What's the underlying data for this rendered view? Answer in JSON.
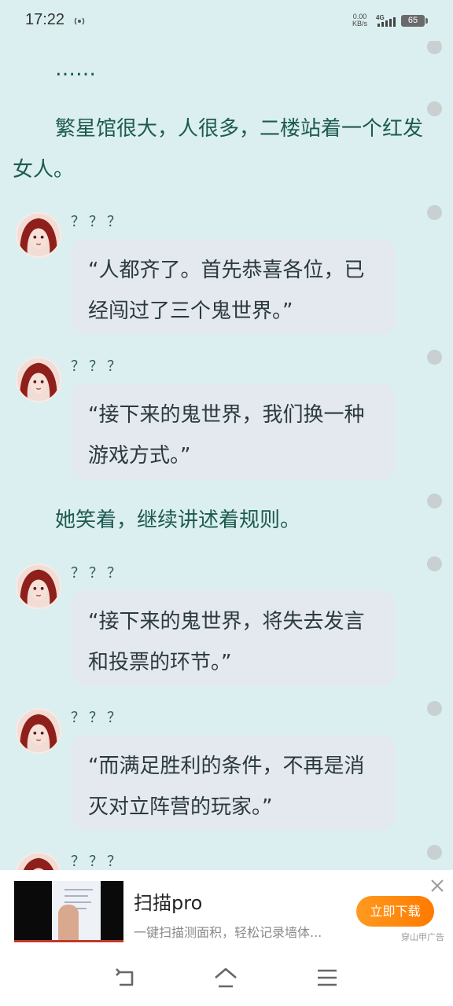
{
  "status_bar": {
    "time": "17:22",
    "net_speed_value": "0.00",
    "net_speed_unit": "KB/s",
    "network": "4G",
    "battery": "65"
  },
  "reader": {
    "paragraphs": [
      "……",
      "繁星馆很大，人很多，二楼站着一个红发女人。",
      "她笑着，继续讲述着规则。"
    ],
    "dialogs": [
      {
        "speaker": "？？？",
        "text": "“人都齐了。首先恭喜各位，已经闯过了三个鬼世界。”"
      },
      {
        "speaker": "？？？",
        "text": "“接下来的鬼世界，我们换一种游戏方式。”"
      },
      {
        "speaker": "？？？",
        "text": "“接下来的鬼世界，将失去发言和投票的环节。”"
      },
      {
        "speaker": "？？？",
        "text": "“而满足胜利的条件，不再是消灭对立阵营的玩家。”"
      },
      {
        "speaker": "？？？",
        "text": ""
      }
    ]
  },
  "ad": {
    "title": "扫描pro",
    "description": "一键扫描测面积，轻松记录墙体...",
    "button_label": "立即下载",
    "source": "穿山甲广告"
  },
  "colors": {
    "background": "#dbeff0",
    "narration_text": "#1d5a4f",
    "bubble_bg": "#e4e9f0",
    "ad_button": "#ff8a0e"
  },
  "icons": {
    "hotspot": "hotspot-icon",
    "signal": "signal-icon",
    "back": "back-icon",
    "home": "home-icon",
    "menu": "menu-icon",
    "close": "close-icon"
  }
}
